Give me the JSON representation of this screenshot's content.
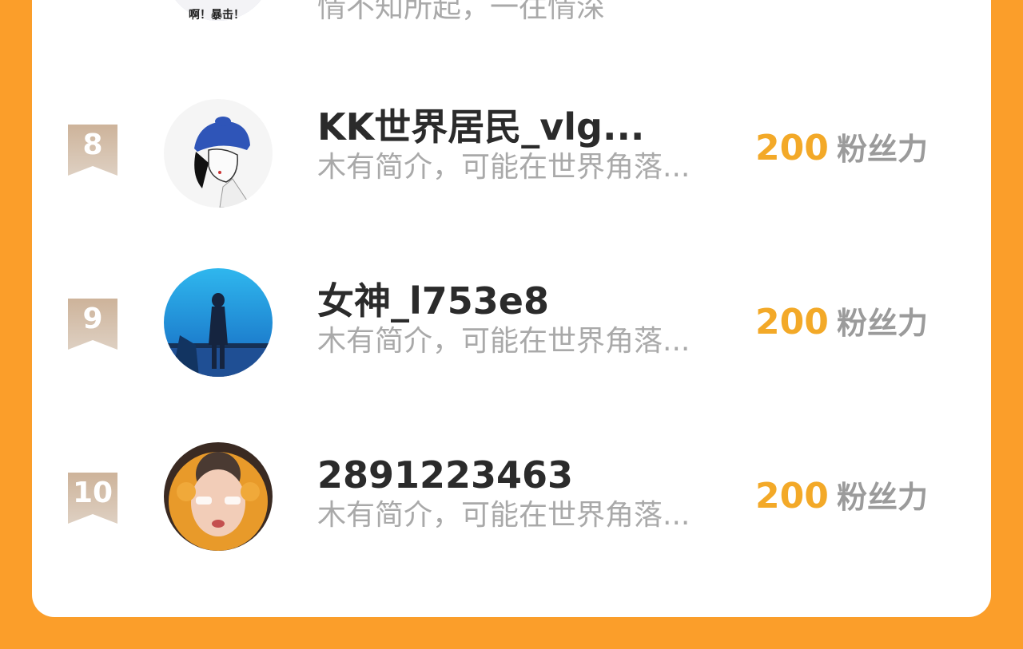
{
  "partial": {
    "intro": "情不知所起，一往情深",
    "avatar_caption": "啊！暴击！"
  },
  "rows": [
    {
      "rank": "8",
      "name": "KK世界居民_vlg...",
      "intro": "木有简介，可能在世界角落...",
      "score": "200",
      "unit": "粉丝力"
    },
    {
      "rank": "9",
      "name": "女神_l753e8",
      "intro": "木有简介，可能在世界角落...",
      "score": "200",
      "unit": "粉丝力"
    },
    {
      "rank": "10",
      "name": "2891223463",
      "intro": "木有简介，可能在世界角落...",
      "score": "200",
      "unit": "粉丝力"
    }
  ],
  "colors": {
    "background": "#FB9E2A",
    "card": "#FFFFFF",
    "score": "#F3A928",
    "badge": "#D7BDA3"
  }
}
